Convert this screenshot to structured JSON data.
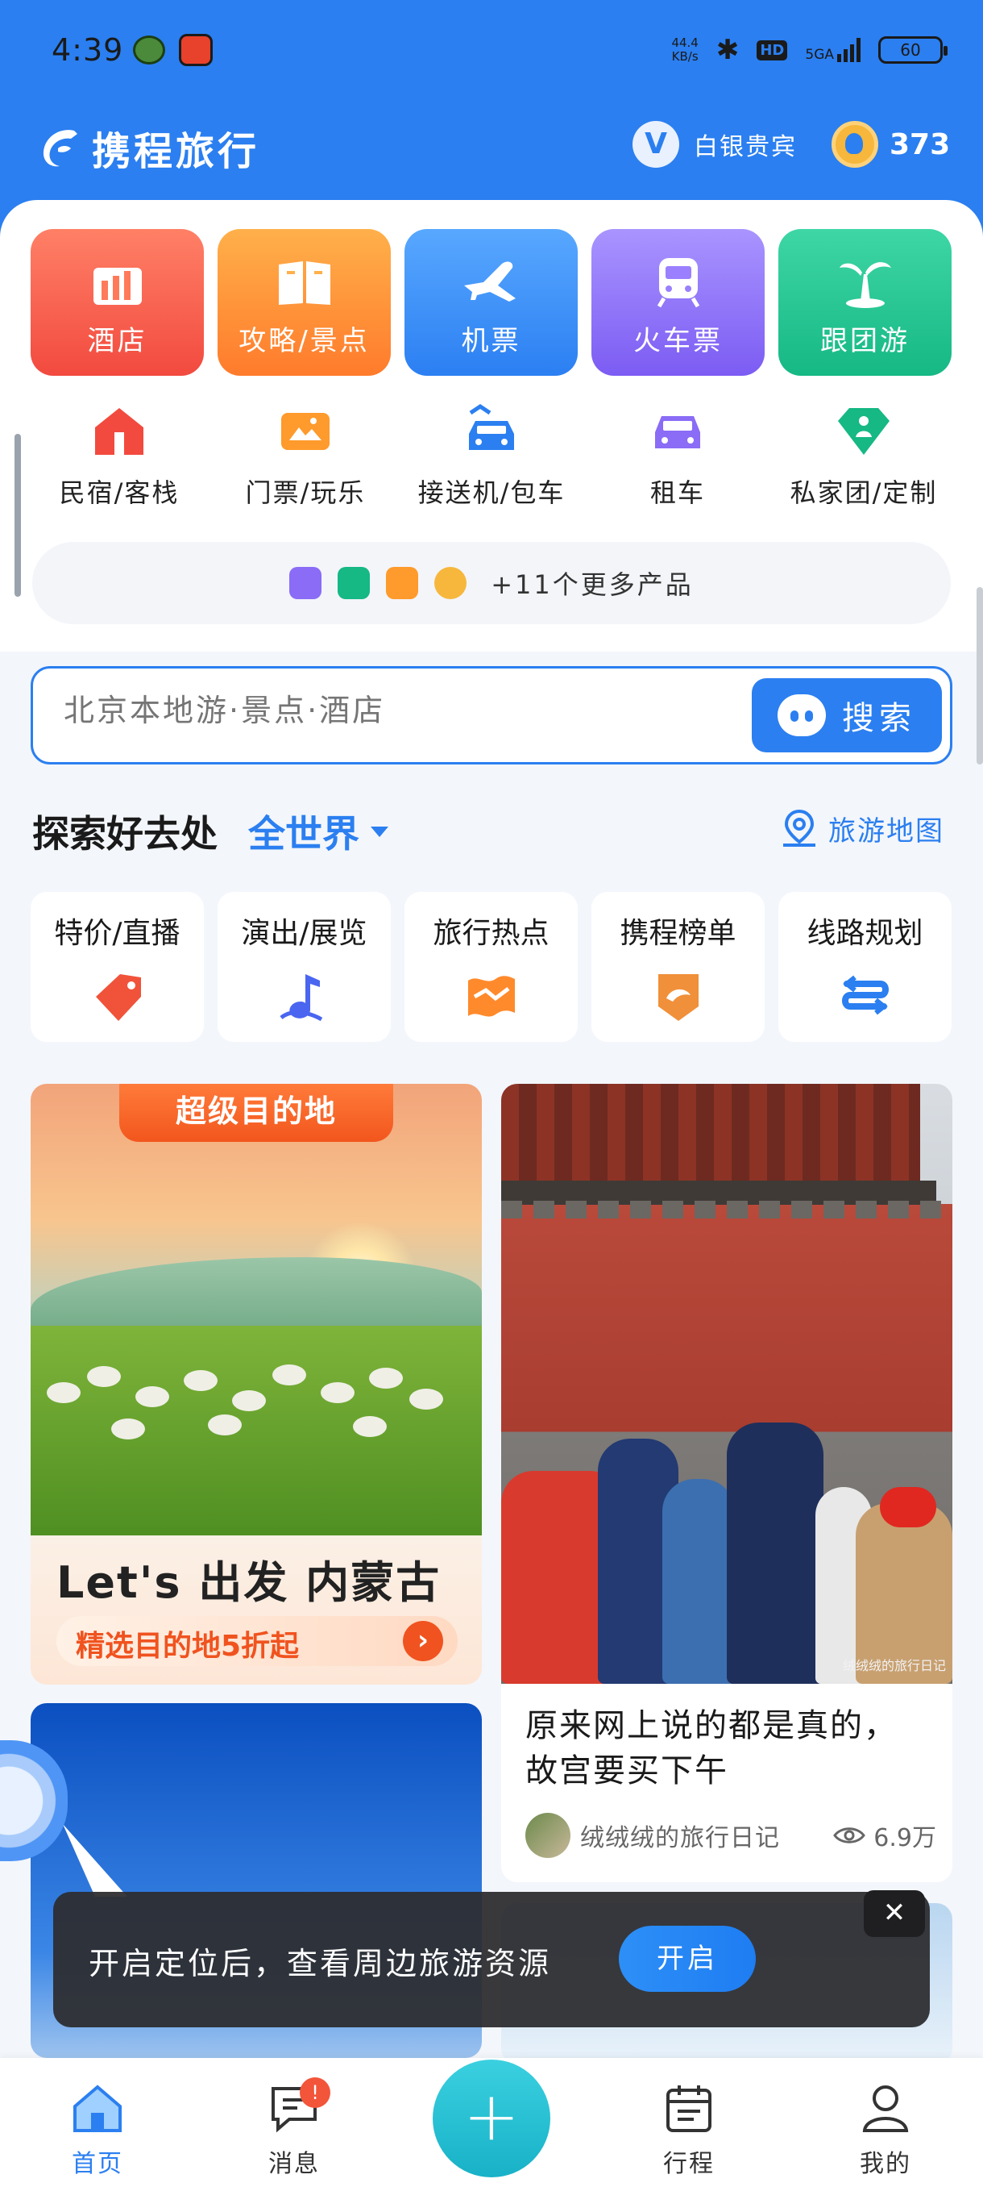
{
  "status_bar": {
    "time": "4:39",
    "net_speed": "44.4",
    "net_unit": "KB/s",
    "hd": "HD",
    "signal": "5GA",
    "battery": "60"
  },
  "header": {
    "brand": "携程旅行",
    "member_badge": "V",
    "member_level": "白银贵宾",
    "coins": "373"
  },
  "main_tiles": [
    {
      "label": "酒店",
      "icon": "hotel-icon"
    },
    {
      "label": "攻略/景点",
      "icon": "guidebook-icon"
    },
    {
      "label": "机票",
      "icon": "airplane-icon"
    },
    {
      "label": "火车票",
      "icon": "train-icon"
    },
    {
      "label": "跟团游",
      "icon": "palm-tree-icon"
    }
  ],
  "sub_nav": [
    {
      "label": "民宿/客栈",
      "icon": "house-icon"
    },
    {
      "label": "门票/玩乐",
      "icon": "ticket-icon"
    },
    {
      "label": "接送机/包车",
      "icon": "shuttle-car-icon"
    },
    {
      "label": "租车",
      "icon": "rental-car-icon"
    },
    {
      "label": "私家团/定制",
      "icon": "private-tour-icon"
    }
  ],
  "more_products": "+11个更多产品",
  "search": {
    "placeholder": "北京本地游·景点·酒店",
    "button": "搜索"
  },
  "explore": {
    "title": "探索好去处",
    "scope": "全世界",
    "map_link": "旅游地图"
  },
  "categories": [
    {
      "label": "特价/直播",
      "icon": "price-tag-icon"
    },
    {
      "label": "演出/展览",
      "icon": "music-note-icon"
    },
    {
      "label": "旅行热点",
      "icon": "hot-flag-icon"
    },
    {
      "label": "携程榜单",
      "icon": "ranking-icon"
    },
    {
      "label": "线路规划",
      "icon": "route-icon"
    }
  ],
  "feed": {
    "promo": {
      "badge": "超级目的地",
      "headline": "Let's 出发 内蒙古",
      "deal": "精选目的地5折起"
    },
    "post": {
      "title": "原来网上说的都是真的，故宫要买下午",
      "author": "绒绒绒的旅行日记",
      "views": "6.9万",
      "watermark": "绒绒绒的旅行日记"
    }
  },
  "toast": {
    "message": "开启定位后，查看周边旅游资源",
    "button": "开启",
    "close": "✕"
  },
  "tabbar": {
    "items": [
      {
        "label": "首页",
        "icon": "home-icon"
      },
      {
        "label": "消息",
        "icon": "message-icon",
        "badge": "!"
      },
      {
        "label": "行程",
        "icon": "calendar-icon"
      },
      {
        "label": "我的",
        "icon": "profile-icon"
      }
    ],
    "fab": "+"
  },
  "colors": {
    "brand_blue": "#2b7ff0",
    "accent_orange": "#f0531f",
    "fab_teal": "#18b1c7"
  }
}
